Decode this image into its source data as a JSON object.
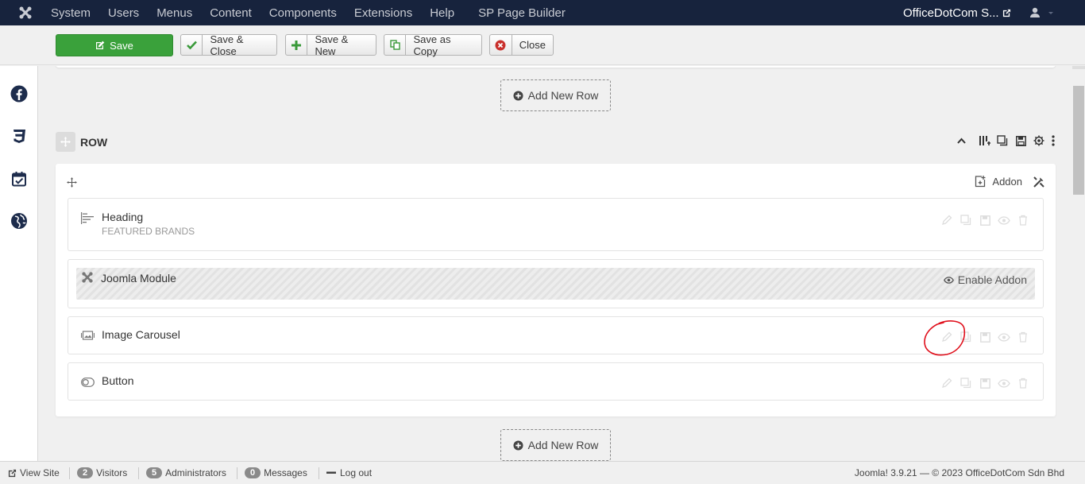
{
  "topnav": {
    "menu": [
      "System",
      "Users",
      "Menus",
      "Content",
      "Components",
      "Extensions",
      "Help",
      "SP Page Builder"
    ],
    "site_name": "OfficeDotCom S..."
  },
  "toolbar": {
    "save_label": "Save",
    "save_close_label": "Save & Close",
    "save_new_label": "Save & New",
    "save_copy_label": "Save as Copy",
    "close_label": "Close"
  },
  "sidebar": {
    "items": [
      "facebook-icon",
      "css3-icon",
      "calendar-check-icon",
      "globe-icon"
    ]
  },
  "builder": {
    "add_row_label": "Add New Row",
    "row_title": "ROW",
    "addon_label": "Addon",
    "enable_addon_label": "Enable Addon",
    "addons": [
      {
        "name": "Heading",
        "subtitle": "FEATURED BRANDS"
      },
      {
        "name": "Joomla Module"
      },
      {
        "name": "Image Carousel"
      },
      {
        "name": "Button"
      }
    ]
  },
  "footer": {
    "view_site": "View Site",
    "visitors_count": "2",
    "visitors_label": "Visitors",
    "admins_count": "5",
    "admins_label": "Administrators",
    "messages_count": "0",
    "messages_label": "Messages",
    "logout": "Log out",
    "version": "Joomla! 3.9.21",
    "copyright": "— © 2023 OfficeDotCom Sdn Bhd"
  },
  "colors": {
    "nav_bg": "#17233d",
    "save_green": "#3aa13b",
    "annotation_red": "#e0101c"
  }
}
